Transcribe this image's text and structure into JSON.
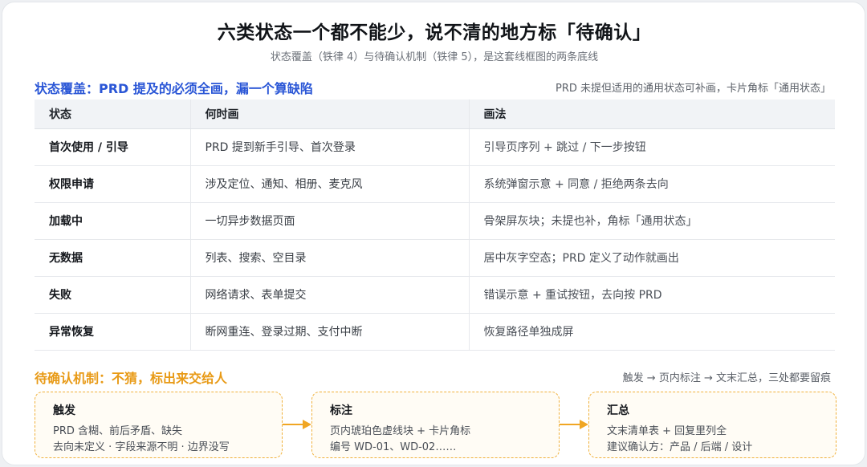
{
  "title": "六类状态一个都不能少，说不清的地方标「待确认」",
  "subtitle": "状态覆盖（铁律 4）与待确认机制（铁律 5），是这套线框图的两条底线",
  "coverage": {
    "heading": "状态覆盖：PRD 提及的必须全画，漏一个算缺陷",
    "note": "PRD 未提但适用的通用状态可补画，卡片角标「通用状态」",
    "columns": [
      "状态",
      "何时画",
      "画法"
    ],
    "rows": [
      {
        "state": "首次使用 / 引导",
        "when": "PRD 提到新手引导、首次登录",
        "how": "引导页序列 + 跳过 / 下一步按钮"
      },
      {
        "state": "权限申请",
        "when": "涉及定位、通知、相册、麦克风",
        "how": "系统弹窗示意 + 同意 / 拒绝两条去向"
      },
      {
        "state": "加载中",
        "when": "一切异步数据页面",
        "how": "骨架屏灰块；未提也补，角标「通用状态」"
      },
      {
        "state": "无数据",
        "when": "列表、搜索、空目录",
        "how": "居中灰字空态；PRD 定义了动作就画出"
      },
      {
        "state": "失败",
        "when": "网络请求、表单提交",
        "how": "错误示意 + 重试按钮，去向按 PRD"
      },
      {
        "state": "异常恢复",
        "when": "断网重连、登录过期、支付中断",
        "how": "恢复路径单独成屏"
      }
    ]
  },
  "pending": {
    "heading": "待确认机制：不猜，标出来交给人",
    "note": "触发 → 页内标注 → 文末汇总，三处都要留痕",
    "accent": "#f0b03a",
    "boxes": [
      {
        "title": "触发",
        "line1": "PRD 含糊、前后矛盾、缺失",
        "line2": "去向未定义 · 字段来源不明 · 边界没写"
      },
      {
        "title": "标注",
        "line1": "页内琥珀色虚线块 + 卡片角标",
        "line2": "编号 WD-01、WD-02……"
      },
      {
        "title": "汇总",
        "line1": "文末清单表 + 回复里列全",
        "line2": "建议确认方：产品 / 后端 / 设计"
      }
    ]
  }
}
